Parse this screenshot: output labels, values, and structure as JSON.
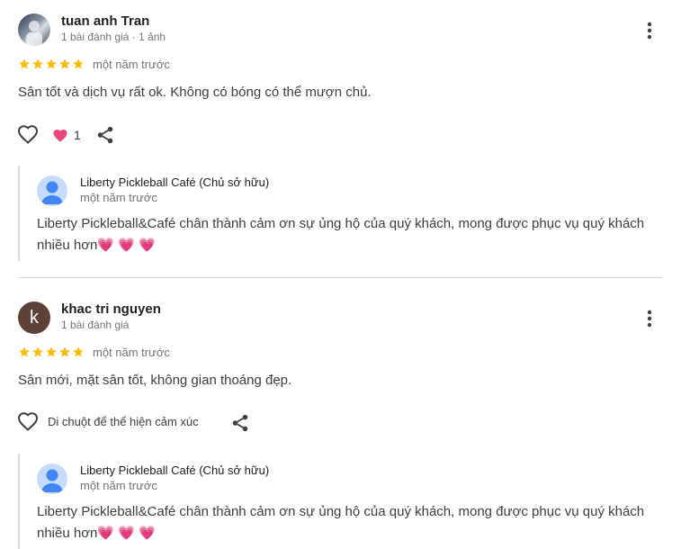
{
  "reviews": [
    {
      "reviewer_name": "tuan anh Tran",
      "reviewer_meta": "1 bài đánh giá · 1 ảnh",
      "rating": 5,
      "date": "một năm trước",
      "text": "Sân tốt và dịch vụ rất ok. Không có bóng có thể mượn chủ.",
      "reaction_count": "1",
      "owner_reply": {
        "name": "Liberty Pickleball Café (Chủ sở hữu)",
        "date": "một năm trước",
        "text": "Liberty Pickleball&Café chân thành cảm ơn sự ủng hộ của quý khách, mong được phục vụ quý khách nhiều hơn💗 💗 💗"
      }
    },
    {
      "reviewer_name": "khac tri nguyen",
      "reviewer_initial": "k",
      "reviewer_meta": "1 bài đánh giá",
      "rating": 5,
      "date": "một năm trước",
      "text": "Sân mới, mặt sân tốt, không gian thoáng đẹp.",
      "hover_hint": "Di chuột để thể hiện cảm xúc",
      "owner_reply": {
        "name": "Liberty Pickleball Café (Chủ sở hữu)",
        "date": "một năm trước",
        "text": "Liberty Pickleball&Café chân thành cảm ơn sự ủng hộ của quý khách, mong được phục vụ quý khách nhiều hơn💗 💗 💗"
      }
    }
  ],
  "colors": {
    "star": "#fbbc04",
    "heart": "#e8457a",
    "divider": "#dadce0"
  },
  "icons": [
    "more-vert-icon",
    "star-icon",
    "heart-outline-icon",
    "heart-filled-icon",
    "share-icon",
    "person-icon"
  ]
}
